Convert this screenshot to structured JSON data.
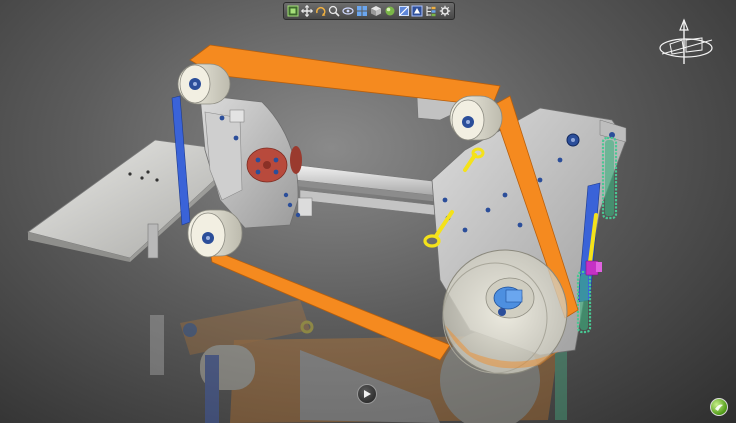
{
  "app": {
    "toolbar": {
      "buttons": [
        {
          "name": "fit-all-icon"
        },
        {
          "name": "pan-icon"
        },
        {
          "name": "rotate-icon"
        },
        {
          "name": "zoom-icon"
        },
        {
          "name": "normal-view-icon"
        },
        {
          "name": "multi-view-icon"
        },
        {
          "name": "isometric-view-icon"
        },
        {
          "name": "shading-icon"
        },
        {
          "name": "hide-show-icon"
        },
        {
          "name": "swap-visible-space-icon"
        },
        {
          "name": "tree-icon"
        },
        {
          "name": "properties-icon"
        }
      ]
    },
    "compass": {
      "icon": "compass-icon"
    },
    "play_button": {
      "icon": "play-icon"
    },
    "logo": {
      "icon": "app-logo-icon"
    }
  },
  "colors": {
    "belt": "#f58a1f",
    "frame": "#c9c9c9",
    "roller": "#e8e5d6",
    "blue_part": "#3a63d8",
    "spring": "#48c893",
    "yellow_handle": "#f4e21a",
    "red_knob": "#b84a3c",
    "magenta": "#c531c5",
    "toolbar_bg": "#5a5a5a",
    "background": "#5c5c5c"
  }
}
